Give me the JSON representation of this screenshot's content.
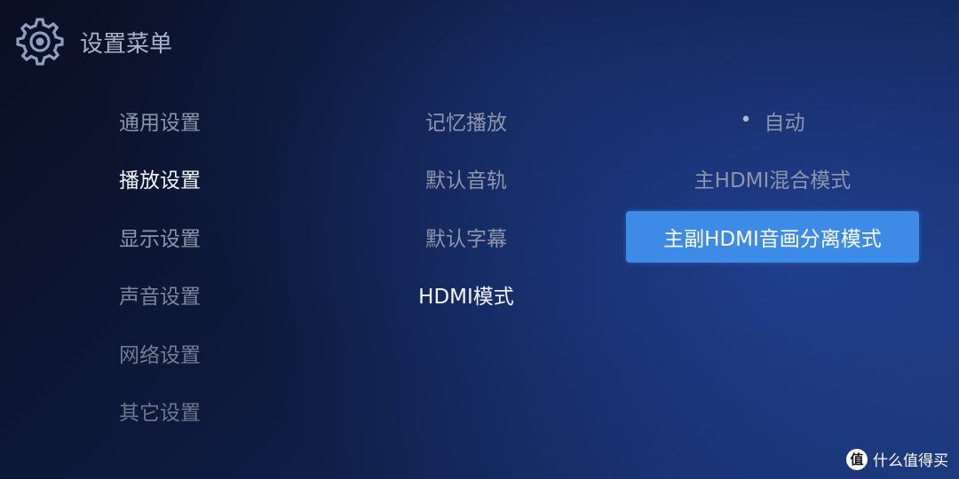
{
  "header": {
    "title": "设置菜单",
    "icon": "gear-icon"
  },
  "categories": [
    {
      "label": "通用设置",
      "state": "normal"
    },
    {
      "label": "播放设置",
      "state": "active"
    },
    {
      "label": "显示设置",
      "state": "normal"
    },
    {
      "label": "声音设置",
      "state": "normal"
    },
    {
      "label": "网络设置",
      "state": "normal"
    },
    {
      "label": "其它设置",
      "state": "normal"
    }
  ],
  "playback_settings": [
    {
      "label": "记忆播放"
    },
    {
      "label": "默认音轨"
    },
    {
      "label": "默认字幕"
    },
    {
      "label": "HDMI模式",
      "state": "active"
    }
  ],
  "hdmi_mode_options": [
    {
      "label": "自动",
      "marker": "•",
      "current": true
    },
    {
      "label": "主HDMI混合模式"
    },
    {
      "label": "主副HDMI音画分离模式",
      "focused": true
    }
  ],
  "watermark": {
    "logo": "值",
    "text": "什么值得买"
  },
  "colors": {
    "focus": "#3d8be6",
    "background": "#0e1a3e"
  }
}
